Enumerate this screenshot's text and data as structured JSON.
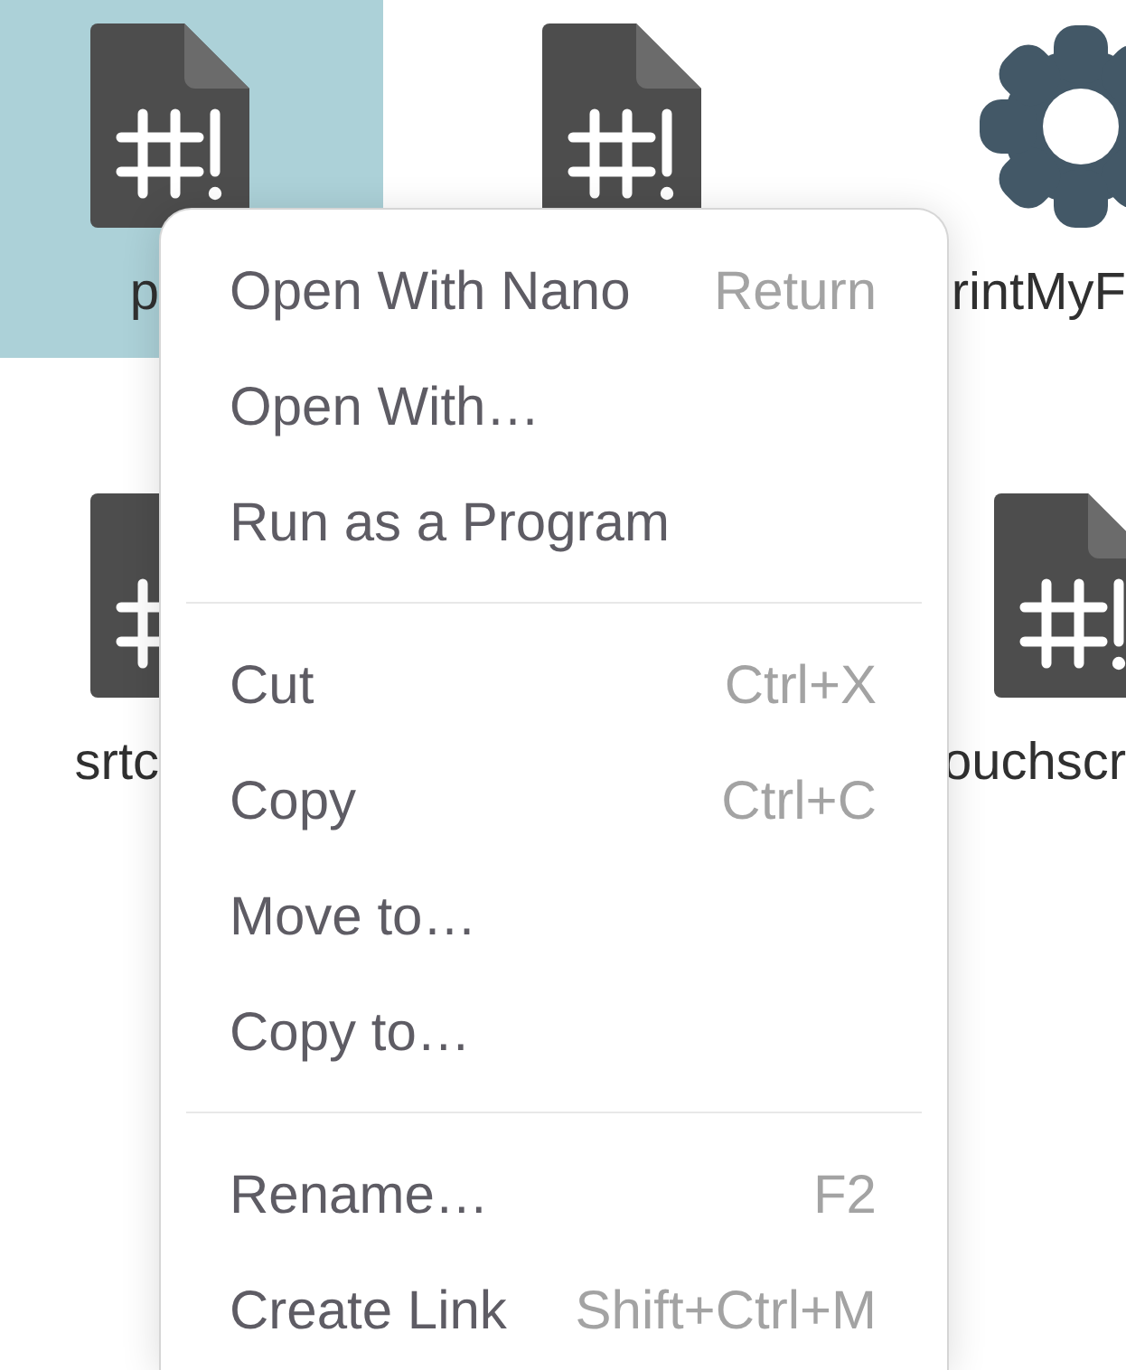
{
  "icon_grid": {
    "rows": [
      {
        "items": [
          {
            "kind": "script",
            "name": "p",
            "selected": true
          },
          {
            "kind": "script",
            "selected": false
          },
          {
            "kind": "executable",
            "name": "rintMyF",
            "selected": false
          }
        ]
      },
      {
        "items": [
          {
            "kind": "script",
            "name": "srtc",
            "selected": false
          },
          {
            "kind": "script",
            "name": "ouchscr",
            "selected": false
          }
        ]
      }
    ]
  },
  "context_menu": {
    "sections": [
      {
        "items": [
          {
            "label": "Open With Nano",
            "shortcut": "Return"
          },
          {
            "label": "Open With…"
          },
          {
            "label": "Run as a Program"
          }
        ]
      },
      {
        "items": [
          {
            "label": "Cut",
            "shortcut": "Ctrl+X"
          },
          {
            "label": "Copy",
            "shortcut": "Ctrl+C"
          },
          {
            "label": "Move to…"
          },
          {
            "label": "Copy to…"
          }
        ]
      },
      {
        "items": [
          {
            "label": "Rename…",
            "shortcut": "F2"
          },
          {
            "label": "Create Link",
            "shortcut": "Shift+Ctrl+M"
          }
        ]
      }
    ]
  }
}
